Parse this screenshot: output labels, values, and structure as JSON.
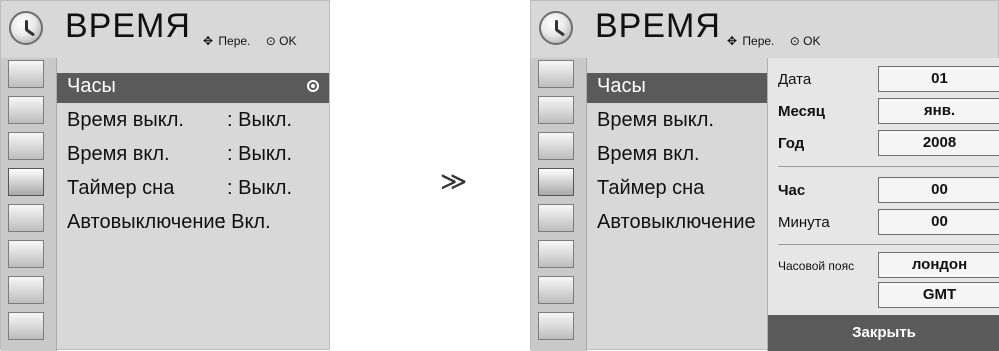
{
  "left": {
    "title": "ВРЕМЯ",
    "hint": {
      "move": "Пере.",
      "ok": "OK"
    },
    "menu": [
      {
        "label": "Часы",
        "value": ""
      },
      {
        "label": "Время выкл.",
        "value": ": Выкл."
      },
      {
        "label": "Время вкл.",
        "value": ": Выкл."
      },
      {
        "label": "Таймер сна",
        "value": ": Выкл."
      },
      {
        "label": "Автовыключение",
        "value": ": Вкл."
      }
    ]
  },
  "arrow": "≫",
  "right": {
    "title": "ВРЕМЯ",
    "hint": {
      "move": "Пере.",
      "ok": "OK"
    },
    "menu": [
      {
        "label": "Часы"
      },
      {
        "label": "Время выкл."
      },
      {
        "label": "Время вкл."
      },
      {
        "label": "Таймер сна"
      },
      {
        "label": "Автовыключение"
      }
    ],
    "popup": {
      "rows": [
        {
          "label": "Дата",
          "value": "01"
        },
        {
          "label": "Месяц",
          "value": "янв."
        },
        {
          "label": "Год",
          "value": "2008"
        },
        {
          "label": "Час",
          "value": "00"
        },
        {
          "label": "Минута",
          "value": "00"
        },
        {
          "label": "Часовой пояс",
          "value": "лондон"
        },
        {
          "label": "",
          "value": "GMT"
        }
      ],
      "close_label": "Закрыть"
    }
  },
  "colors": {
    "panel_bg": "#d8d8d8",
    "selected_bg": "#5a5a5a",
    "popup_bg": "#e6e6e6"
  }
}
